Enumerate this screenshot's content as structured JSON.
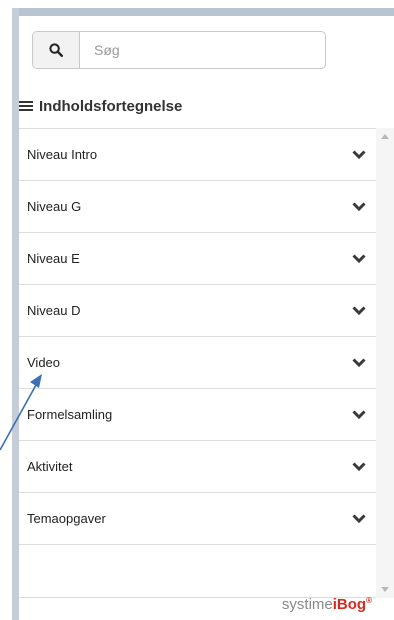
{
  "search": {
    "placeholder": "Søg",
    "value": ""
  },
  "toc": {
    "title": "Indholdsfortegnelse"
  },
  "items": [
    {
      "label": "Niveau Intro"
    },
    {
      "label": "Niveau G"
    },
    {
      "label": "Niveau E"
    },
    {
      "label": "Niveau D"
    },
    {
      "label": "Video"
    },
    {
      "label": "Formelsamling"
    },
    {
      "label": "Aktivitet"
    },
    {
      "label": "Temaopgaver"
    }
  ],
  "brand": {
    "light": "systime",
    "bold": "iBog",
    "mark": "®"
  },
  "colors": {
    "accent": "#d52b1e",
    "border": "#dcdcdc",
    "annotation": "#3b6fb6"
  },
  "icons": {
    "search": "search-icon",
    "menu": "menu-icon",
    "chevron": "chevron-down-icon"
  }
}
